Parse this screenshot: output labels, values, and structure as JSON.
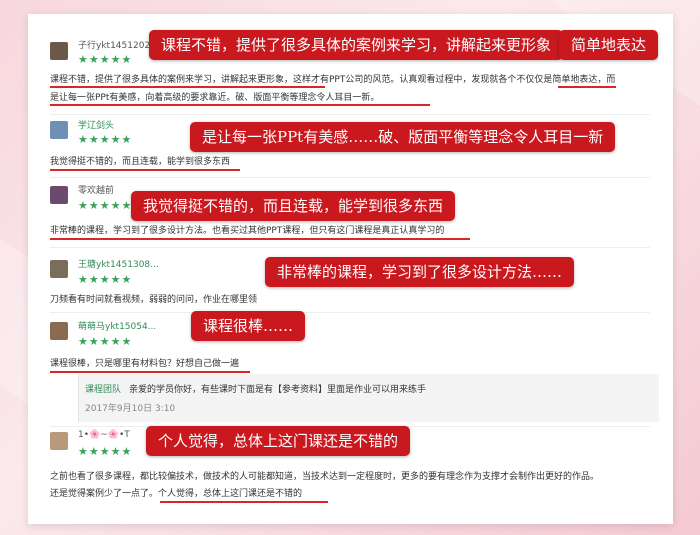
{
  "reviews": [
    {
      "user": "子行ykt1451202",
      "stars": "★★★★★",
      "lines": [
        "课程不错，提供了很多具体的案例来学习，讲解起来更形象，这样才有PPT公司的风范。认真观看过程中，发现就各个不仅仅是简单地表达，而",
        "是让每一张PPt有美感，向着高级的要求靠近。破、版面平衡等理念令人耳目一新。"
      ]
    },
    {
      "user": "学辽剑头",
      "stars": "★★★★★",
      "lines": [
        "我觉得挺不错的，而且连载，能学到很多东西"
      ]
    },
    {
      "user": "零欢越前",
      "stars": "★★★★★",
      "lines": [
        "非常棒的课程，学习到了很多设计方法。也看买过其他PPT课程，但只有这门课程是真正认真学习的"
      ]
    },
    {
      "user": "王瑭ykt1451308...",
      "stars": "★★★★★",
      "lines": [
        "刀频看有时间就看视频，弱弱的问问，作业在哪里领"
      ]
    },
    {
      "user": "萌萌马ykt15054...",
      "stars": "★★★★★",
      "lines": [
        "课程很棒，只是哪里有材料包？好想自己做一遍"
      ]
    },
    {
      "user": "1•🌸~🌸•T",
      "stars": "★★★★★",
      "lines": [
        "之前也看了很多课程，都比较偏技术，做技术的人可能都知道，当技术达到一定程度时，更多的要有理念作为支撑才会制作出更好的作品。",
        "还是觉得案例少了一点了。个人觉得，总体上这门课还是不错的"
      ]
    }
  ],
  "reply": {
    "name": "课程团队",
    "text": "亲爱的学员你好，有些课时下面是有【参考资料】里面是作业可以用来练手",
    "date": "2017年9月10日 3:10"
  },
  "callouts": {
    "c1": "课程不错，提供了很多具体的案例来学习，讲解起来更形象",
    "c2": "简单地表达",
    "c3": "是让每一张PPt有美感……破、版面平衡等理念令人耳目一新",
    "c4": "我觉得挺不错的，而且连载，能学到很多东西",
    "c5": "非常棒的课程，学习到了很多设计方法……",
    "c6": "课程很棒……",
    "c7": "个人觉得，总体上这门课还是不错的"
  },
  "colors": {
    "callout_bg": "#c9191f",
    "star": "#3aa15a",
    "underline": "#d9262b",
    "bg": "#f7d7dd"
  }
}
